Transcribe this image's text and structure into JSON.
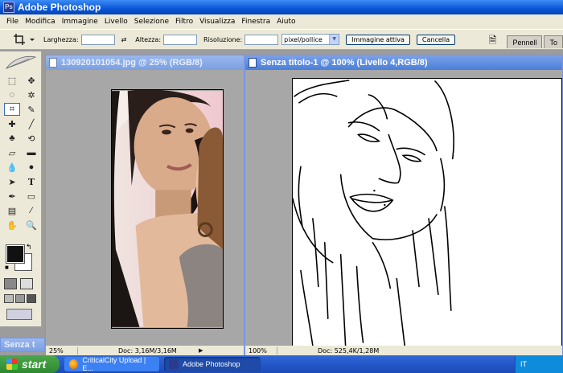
{
  "app": {
    "title": "Adobe Photoshop"
  },
  "menu": [
    "File",
    "Modifica",
    "Immagine",
    "Livello",
    "Selezione",
    "Filtro",
    "Visualizza",
    "Finestra",
    "Aiuto"
  ],
  "options": {
    "width_label": "Larghezza:",
    "height_label": "Altezza:",
    "resolution_label": "Risoluzione:",
    "resolution_unit": "pixel/pollice",
    "front_image_button": "Immagine attiva",
    "clear_button": "Cancella",
    "palette_tabs": [
      "Pennell",
      "To"
    ]
  },
  "windows": {
    "photo": {
      "title": "130920101054.jpg @ 25% (RGB/8)",
      "zoom": "25%",
      "doc_info": "Doc: 3,16M/3,16M"
    },
    "drawing": {
      "title": "Senza titolo-1 @ 100% (Livello 4,RGB/8)",
      "zoom": "100%",
      "doc_info": "Doc: 525,4K/1,28M"
    },
    "minimized": {
      "title": "Senza t"
    }
  },
  "taskbar": {
    "start": "start",
    "tasks": [
      {
        "label": "CriticalCity Upload | E...",
        "active": false
      },
      {
        "label": "Adobe Photoshop",
        "active": true
      }
    ],
    "lang": "IT"
  },
  "colors": {
    "accent": "#0a56d8",
    "taskbar": "#2457c9",
    "start": "#3c9a3c"
  }
}
